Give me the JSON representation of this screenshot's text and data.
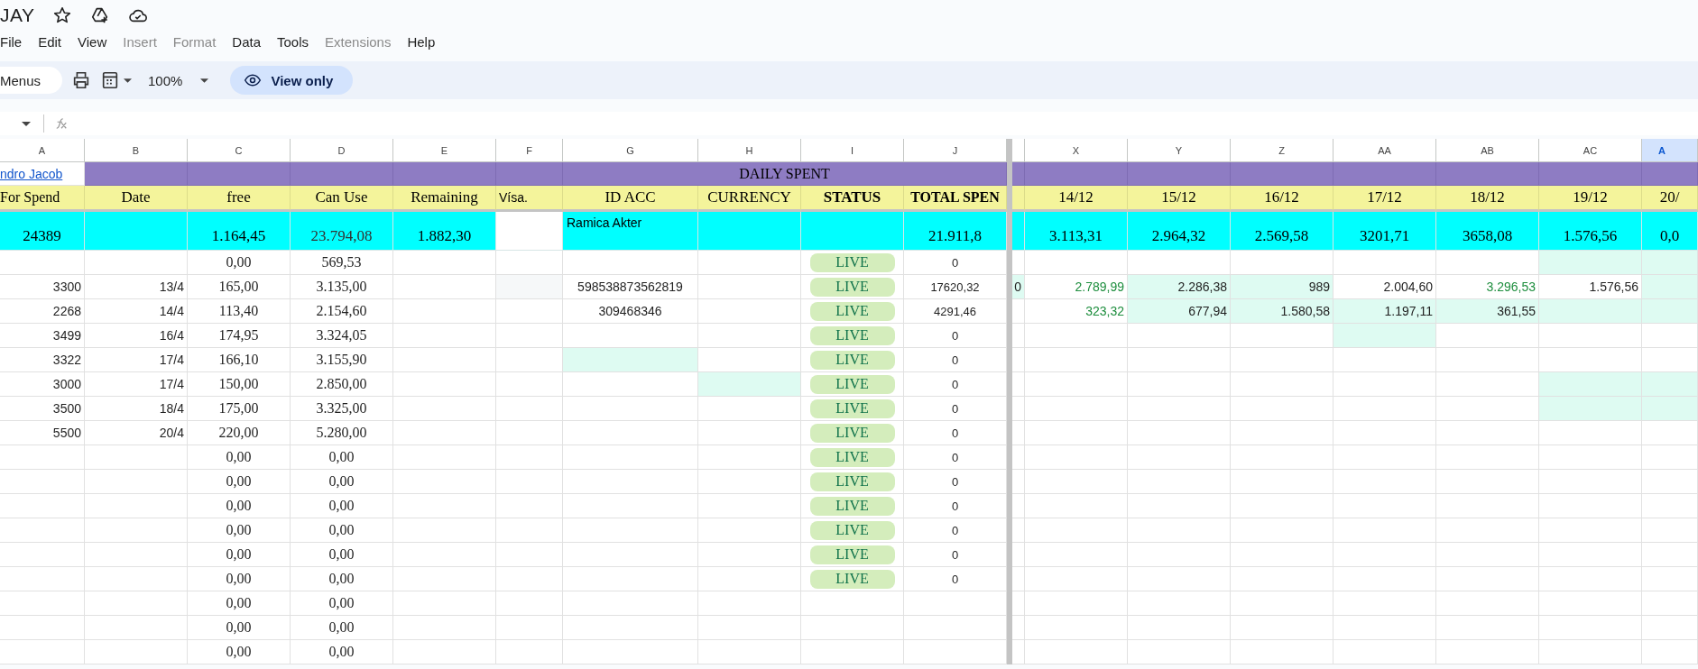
{
  "document": {
    "title": "JAY"
  },
  "menu": [
    {
      "label": "File",
      "disabled": false
    },
    {
      "label": "Edit",
      "disabled": false
    },
    {
      "label": "View",
      "disabled": false
    },
    {
      "label": "Insert",
      "disabled": true
    },
    {
      "label": "Format",
      "disabled": true
    },
    {
      "label": "Data",
      "disabled": false
    },
    {
      "label": "Tools",
      "disabled": false
    },
    {
      "label": "Extensions",
      "disabled": true
    },
    {
      "label": "Help",
      "disabled": false
    }
  ],
  "toolbar": {
    "menus_button": "Menus",
    "zoom": "100%",
    "mode_button": "View only"
  },
  "columns": [
    {
      "letter": "A",
      "selected": false
    },
    {
      "letter": "B",
      "selected": false
    },
    {
      "letter": "C",
      "selected": false
    },
    {
      "letter": "D",
      "selected": false
    },
    {
      "letter": "E",
      "selected": false
    },
    {
      "letter": "F",
      "selected": false
    },
    {
      "letter": "G",
      "selected": false
    },
    {
      "letter": "H",
      "selected": false
    },
    {
      "letter": "I",
      "selected": false
    },
    {
      "letter": "J",
      "selected": false
    },
    {
      "selected": false
    },
    {
      "letter": "X",
      "selected": false
    },
    {
      "letter": "Y",
      "selected": false
    },
    {
      "letter": "Z",
      "selected": false
    },
    {
      "letter": "AA",
      "selected": false
    },
    {
      "letter": "AB",
      "selected": false
    },
    {
      "letter": "AC",
      "selected": false
    },
    {
      "letter": "A",
      "selected": true
    }
  ],
  "title_row": {
    "link": "ndro Jacob",
    "banner": "DAILY SPENT"
  },
  "header_row": [
    {
      "text": "For Spend",
      "color": "#f4f49b"
    },
    {
      "text": "Date",
      "color": "#f4f49b"
    },
    {
      "text": "free",
      "color": "#f4f49b"
    },
    {
      "text": "Can Use",
      "color": "#f4f49b"
    },
    {
      "text": "Remaining",
      "color": "#f4f49b"
    },
    {
      "text": "Vísa.",
      "color": "#f4f49b"
    },
    {
      "text": "ID ACC",
      "color": "#f4f49b"
    },
    {
      "text": "CURRENCY",
      "color": "#f4f49b"
    },
    {
      "text": "STATUS",
      "color": "#f4f49b"
    },
    {
      "text": "TOTAL SPEN",
      "color": "#f4f49b"
    },
    {
      "color": "#f4f49b"
    },
    {
      "text": "14/12",
      "color": "#f4f49b"
    },
    {
      "text": "15/12",
      "color": "#f4f49b"
    },
    {
      "text": "16/12",
      "color": "#f4f49b"
    },
    {
      "text": "17/12",
      "color": "#f4f49b"
    },
    {
      "text": "18/12",
      "color": "#f4f49b"
    },
    {
      "text": "19/12",
      "color": "#f4f49b"
    },
    {
      "text": "20/",
      "color": "#f4f49b"
    }
  ],
  "totals_row": [
    {
      "text": "24389",
      "color": "#00ffff"
    },
    {
      "color": "#00ffff"
    },
    {
      "text": "1.164,45",
      "color": "#00ffff"
    },
    {
      "text": "23.794,08",
      "color": "#00ffff"
    },
    {
      "text": "1.882,30",
      "color": "#00ffff"
    },
    {
      "color": "#ffffff"
    },
    {
      "text": "Ramica Akter",
      "color": "#00ffff"
    },
    {
      "color": "#00ffff"
    },
    {
      "color": "#00ffff"
    },
    {
      "text": "21.911,8",
      "color": "#00ffff"
    },
    {
      "color": "#00ffff"
    },
    {
      "text": "3.113,31",
      "color": "#00ffff"
    },
    {
      "text": "2.964,32",
      "color": "#00ffff"
    },
    {
      "text": "2.569,58",
      "color": "#00ffff"
    },
    {
      "text": "3201,71",
      "color": "#00ffff"
    },
    {
      "text": "3658,08",
      "color": "#00ffff"
    },
    {
      "text": "1.576,56",
      "color": "#00ffff"
    },
    {
      "text": "0,0",
      "color": "#00ffff"
    }
  ],
  "rows": [
    {
      "cells": [
        {
          "kind": "empty"
        },
        {
          "kind": "empty"
        },
        "0,00",
        "569,53",
        {
          "kind": "empty"
        },
        {
          "kind": "empty"
        },
        {
          "kind": "empty"
        },
        {
          "kind": "empty"
        },
        {
          "text": "LIVE",
          "kind": "status"
        },
        "0",
        {
          "kind": "empty"
        },
        {
          "kind": "empty"
        },
        {
          "kind": "empty"
        },
        {
          "kind": "empty"
        },
        {
          "kind": "empty"
        },
        {
          "kind": "empty"
        },
        {
          "kind": "empty",
          "shaded": true
        },
        {
          "kind": "empty",
          "shaded": true
        }
      ]
    },
    {
      "cells": [
        "3300",
        "13/4",
        "165,00",
        "3.135,00",
        {
          "kind": "empty"
        },
        {
          "kind": "empty",
          "shaded": true
        },
        "598538873562819",
        {
          "kind": "empty"
        },
        {
          "text": "LIVE",
          "kind": "status"
        },
        "17620,32",
        {
          "text": "0",
          "shaded": true
        },
        {
          "text": "2.789,99",
          "green": true
        },
        {
          "text": "2.286,38",
          "shaded": true
        },
        {
          "text": "989",
          "shaded": true
        },
        "2.004,60",
        {
          "text": "3.296,53",
          "green": true
        },
        "1.576,56",
        {
          "kind": "empty",
          "shaded": true
        }
      ]
    },
    {
      "cells": [
        "2268",
        "14/4",
        "113,40",
        "2.154,60",
        {
          "kind": "empty"
        },
        {
          "kind": "empty"
        },
        "309468346",
        {
          "kind": "empty"
        },
        {
          "text": "LIVE",
          "kind": "status"
        },
        "4291,46",
        {
          "kind": "empty"
        },
        {
          "text": "323,32",
          "green": true
        },
        {
          "text": "677,94",
          "shaded": true
        },
        {
          "text": "1.580,58",
          "shaded": true
        },
        {
          "text": "1.197,11",
          "shaded": true
        },
        {
          "text": "361,55",
          "shaded": true
        },
        {
          "kind": "empty",
          "shaded": true
        },
        {
          "kind": "empty",
          "shaded": true
        }
      ]
    },
    {
      "cells": [
        "3499",
        "16/4",
        "174,95",
        "3.324,05",
        {
          "kind": "empty"
        },
        {
          "kind": "empty"
        },
        {
          "kind": "empty"
        },
        {
          "kind": "empty"
        },
        {
          "text": "LIVE",
          "kind": "status"
        },
        "0",
        {
          "kind": "empty"
        },
        {
          "kind": "empty"
        },
        {
          "kind": "empty"
        },
        {
          "kind": "empty"
        },
        {
          "kind": "empty",
          "shaded": true
        },
        {
          "kind": "empty"
        },
        {
          "kind": "empty"
        },
        {
          "kind": "empty"
        }
      ]
    },
    {
      "cells": [
        "3322",
        "17/4",
        "166,10",
        "3.155,90",
        {
          "kind": "empty"
        },
        {
          "kind": "empty"
        },
        {
          "kind": "empty",
          "shaded": true
        },
        {
          "kind": "empty"
        },
        {
          "text": "LIVE",
          "kind": "status"
        },
        "0",
        {
          "kind": "empty"
        },
        {
          "kind": "empty"
        },
        {
          "kind": "empty"
        },
        {
          "kind": "empty"
        },
        {
          "kind": "empty"
        },
        {
          "kind": "empty"
        },
        {
          "kind": "empty"
        },
        {
          "kind": "empty"
        }
      ]
    },
    {
      "cells": [
        "3000",
        "17/4",
        "150,00",
        "2.850,00",
        {
          "kind": "empty"
        },
        {
          "kind": "empty"
        },
        {
          "kind": "empty"
        },
        {
          "kind": "empty",
          "shaded": true
        },
        {
          "text": "LIVE",
          "kind": "status"
        },
        "0",
        {
          "kind": "empty"
        },
        {
          "kind": "empty"
        },
        {
          "kind": "empty"
        },
        {
          "kind": "empty"
        },
        {
          "kind": "empty"
        },
        {
          "kind": "empty"
        },
        {
          "kind": "empty",
          "shaded": true
        },
        {
          "kind": "empty",
          "shaded": true
        }
      ]
    },
    {
      "cells": [
        "3500",
        "18/4",
        "175,00",
        "3.325,00",
        {
          "kind": "empty"
        },
        {
          "kind": "empty"
        },
        {
          "kind": "empty"
        },
        {
          "kind": "empty"
        },
        {
          "text": "LIVE",
          "kind": "status"
        },
        "0",
        {
          "kind": "empty"
        },
        {
          "kind": "empty"
        },
        {
          "kind": "empty"
        },
        {
          "kind": "empty"
        },
        {
          "kind": "empty"
        },
        {
          "kind": "empty"
        },
        {
          "kind": "empty",
          "shaded": true
        },
        {
          "kind": "empty",
          "shaded": true
        }
      ]
    },
    {
      "cells": [
        "5500",
        "20/4",
        "220,00",
        "5.280,00",
        {
          "kind": "empty"
        },
        {
          "kind": "empty"
        },
        {
          "kind": "empty"
        },
        {
          "kind": "empty"
        },
        {
          "text": "LIVE",
          "kind": "status"
        },
        "0",
        {
          "kind": "empty"
        },
        {
          "kind": "empty"
        },
        {
          "kind": "empty"
        },
        {
          "kind": "empty"
        },
        {
          "kind": "empty"
        },
        {
          "kind": "empty"
        },
        {
          "kind": "empty"
        },
        {
          "kind": "empty"
        }
      ]
    },
    {
      "cells": [
        {
          "kind": "empty"
        },
        {
          "kind": "empty"
        },
        "0,00",
        "0,00",
        {
          "kind": "empty"
        },
        {
          "kind": "empty"
        },
        {
          "kind": "empty"
        },
        {
          "kind": "empty"
        },
        {
          "text": "LIVE",
          "kind": "status"
        },
        "0",
        {
          "kind": "empty"
        },
        {
          "kind": "empty"
        },
        {
          "kind": "empty"
        },
        {
          "kind": "empty"
        },
        {
          "kind": "empty"
        },
        {
          "kind": "empty"
        },
        {
          "kind": "empty"
        },
        {
          "kind": "empty"
        }
      ]
    },
    {
      "cells": [
        {
          "kind": "empty"
        },
        {
          "kind": "empty"
        },
        "0,00",
        "0,00",
        {
          "kind": "empty"
        },
        {
          "kind": "empty"
        },
        {
          "kind": "empty"
        },
        {
          "kind": "empty"
        },
        {
          "text": "LIVE",
          "kind": "status"
        },
        "0",
        {
          "kind": "empty"
        },
        {
          "kind": "empty"
        },
        {
          "kind": "empty"
        },
        {
          "kind": "empty"
        },
        {
          "kind": "empty"
        },
        {
          "kind": "empty"
        },
        {
          "kind": "empty"
        },
        {
          "kind": "empty"
        }
      ]
    },
    {
      "cells": [
        {
          "kind": "empty"
        },
        {
          "kind": "empty"
        },
        "0,00",
        "0,00",
        {
          "kind": "empty"
        },
        {
          "kind": "empty"
        },
        {
          "kind": "empty"
        },
        {
          "kind": "empty"
        },
        {
          "text": "LIVE",
          "kind": "status"
        },
        "0",
        {
          "kind": "empty"
        },
        {
          "kind": "empty"
        },
        {
          "kind": "empty"
        },
        {
          "kind": "empty"
        },
        {
          "kind": "empty"
        },
        {
          "kind": "empty"
        },
        {
          "kind": "empty"
        },
        {
          "kind": "empty"
        }
      ]
    },
    {
      "cells": [
        {
          "kind": "empty"
        },
        {
          "kind": "empty"
        },
        "0,00",
        "0,00",
        {
          "kind": "empty"
        },
        {
          "kind": "empty"
        },
        {
          "kind": "empty"
        },
        {
          "kind": "empty"
        },
        {
          "text": "LIVE",
          "kind": "status"
        },
        "0",
        {
          "kind": "empty"
        },
        {
          "kind": "empty"
        },
        {
          "kind": "empty"
        },
        {
          "kind": "empty"
        },
        {
          "kind": "empty"
        },
        {
          "kind": "empty"
        },
        {
          "kind": "empty"
        },
        {
          "kind": "empty"
        }
      ]
    },
    {
      "cells": [
        {
          "kind": "empty"
        },
        {
          "kind": "empty"
        },
        "0,00",
        "0,00",
        {
          "kind": "empty"
        },
        {
          "kind": "empty"
        },
        {
          "kind": "empty"
        },
        {
          "kind": "empty"
        },
        {
          "text": "LIVE",
          "kind": "status"
        },
        "0",
        {
          "kind": "empty"
        },
        {
          "kind": "empty"
        },
        {
          "kind": "empty"
        },
        {
          "kind": "empty"
        },
        {
          "kind": "empty"
        },
        {
          "kind": "empty"
        },
        {
          "kind": "empty"
        },
        {
          "kind": "empty"
        }
      ]
    },
    {
      "cells": [
        {
          "kind": "empty"
        },
        {
          "kind": "empty"
        },
        "0,00",
        "0,00",
        {
          "kind": "empty"
        },
        {
          "kind": "empty"
        },
        {
          "kind": "empty"
        },
        {
          "kind": "empty"
        },
        {
          "text": "LIVE",
          "kind": "status"
        },
        "0",
        {
          "kind": "empty"
        },
        {
          "kind": "empty"
        },
        {
          "kind": "empty"
        },
        {
          "kind": "empty"
        },
        {
          "kind": "empty"
        },
        {
          "kind": "empty"
        },
        {
          "kind": "empty"
        },
        {
          "kind": "empty"
        }
      ]
    },
    {
      "cells": [
        {
          "kind": "empty"
        },
        {
          "kind": "empty"
        },
        "0,00",
        "0,00",
        {
          "kind": "empty"
        },
        {
          "kind": "empty"
        },
        {
          "kind": "empty"
        },
        {
          "kind": "empty"
        },
        {
          "kind": "empty"
        },
        {
          "kind": "empty"
        },
        {
          "kind": "empty"
        },
        {
          "kind": "empty"
        },
        {
          "kind": "empty"
        },
        {
          "kind": "empty"
        },
        {
          "kind": "empty"
        },
        {
          "kind": "empty"
        },
        {
          "kind": "empty"
        },
        {
          "kind": "empty"
        }
      ]
    },
    {
      "cells": [
        {
          "kind": "empty"
        },
        {
          "kind": "empty"
        },
        "0,00",
        "0,00",
        {
          "kind": "empty"
        },
        {
          "kind": "empty"
        },
        {
          "kind": "empty"
        },
        {
          "kind": "empty"
        },
        {
          "kind": "empty"
        },
        {
          "kind": "empty"
        },
        {
          "kind": "empty"
        },
        {
          "kind": "empty"
        },
        {
          "kind": "empty"
        },
        {
          "kind": "empty"
        },
        {
          "kind": "empty"
        },
        {
          "kind": "empty"
        },
        {
          "kind": "empty"
        },
        {
          "kind": "empty"
        }
      ]
    },
    {
      "cells": [
        {
          "kind": "empty"
        },
        {
          "kind": "empty"
        },
        "0,00",
        "0,00",
        {
          "kind": "empty"
        },
        {
          "kind": "empty"
        },
        {
          "kind": "empty"
        },
        {
          "kind": "empty"
        },
        {
          "kind": "empty"
        },
        {
          "kind": "empty"
        },
        {
          "kind": "empty"
        },
        {
          "kind": "empty"
        },
        {
          "kind": "empty"
        },
        {
          "kind": "empty"
        },
        {
          "kind": "empty"
        },
        {
          "kind": "empty"
        },
        {
          "kind": "empty"
        },
        {
          "kind": "empty"
        }
      ]
    }
  ]
}
